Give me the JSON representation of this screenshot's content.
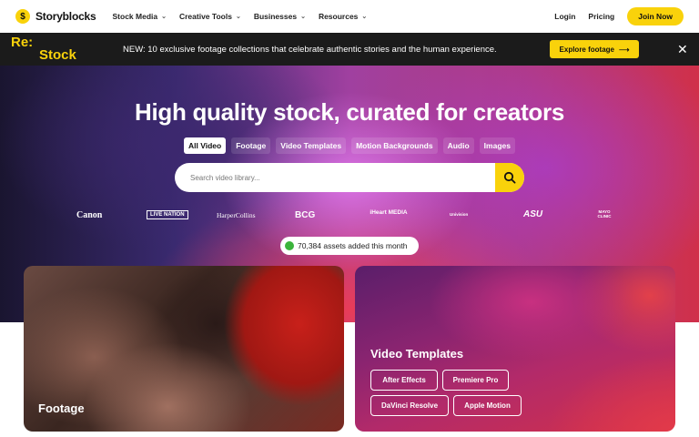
{
  "nav": {
    "logo_mark": "$",
    "logo_text": "Storyblocks",
    "menu": [
      {
        "label": "Stock Media"
      },
      {
        "label": "Creative Tools"
      },
      {
        "label": "Businesses"
      },
      {
        "label": "Resources"
      }
    ],
    "login": "Login",
    "pricing": "Pricing",
    "join": "Join Now"
  },
  "banner": {
    "restock_line1": "Re:",
    "restock_line2": "Stock",
    "text": "NEW: 10 exclusive footage collections that celebrate authentic stories and the human experience.",
    "cta": "Explore footage",
    "cta_arrow": "⟶",
    "close": "✕"
  },
  "hero": {
    "title": "High quality stock, curated for creators",
    "filters": [
      "All Video",
      "Footage",
      "Video Templates",
      "Motion Backgrounds",
      "Audio",
      "Images"
    ],
    "active_filter": "All Video",
    "search_placeholder": "Search video library...",
    "brands": [
      "Canon",
      "LIVE NATION",
      "HarperCollins",
      "BCG",
      "iHeart MEDIA",
      "Univision",
      "ASU",
      "MAYO CLINIC"
    ],
    "assets_text": "70,384 assets added this month"
  },
  "cards": {
    "footage_title": "Footage",
    "templates_title": "Video Templates",
    "template_buttons": [
      "After Effects",
      "Premiere Pro",
      "DaVinci Resolve",
      "Apple Motion"
    ]
  },
  "colors": {
    "accent": "#f9d20b",
    "banner_bg": "#1b1b1b",
    "status_dot": "#3cb43c"
  }
}
